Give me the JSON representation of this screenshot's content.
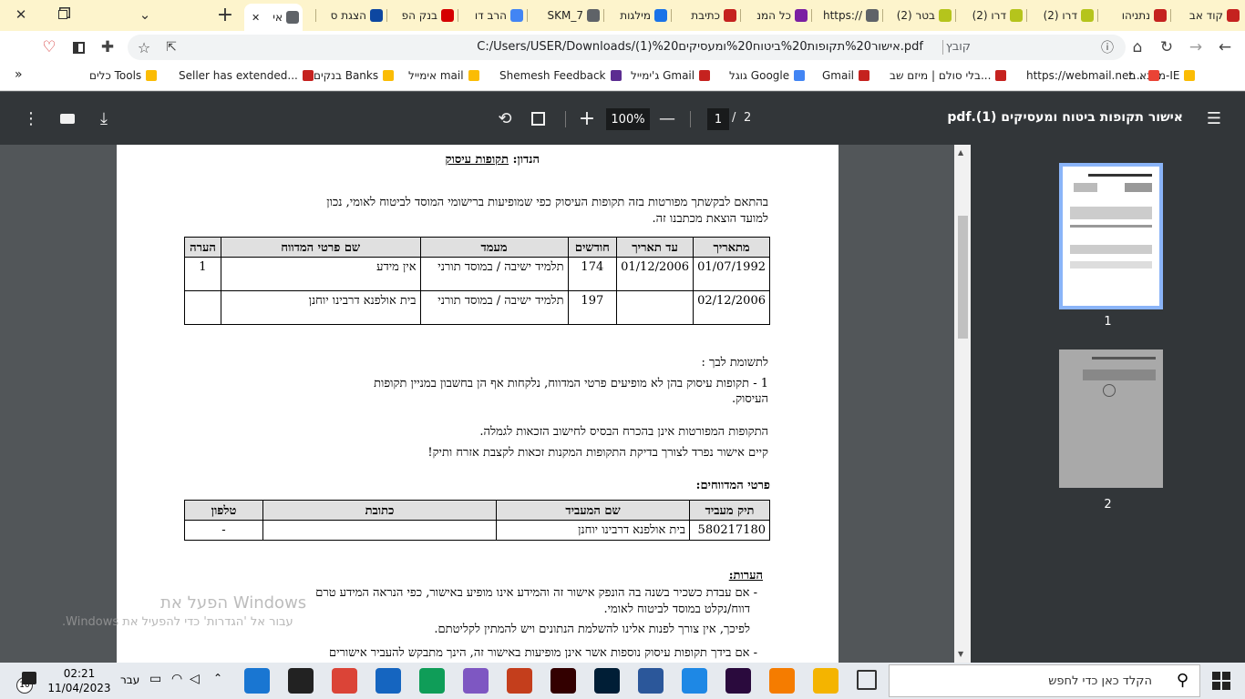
{
  "browser": {
    "tabs": [
      {
        "label": "קוד אב",
        "color": "#c5221f"
      },
      {
        "label": "נתניהו",
        "color": "#c5221f"
      },
      {
        "label": "(2) דרו",
        "color": "#b5c41c"
      },
      {
        "label": "(2) דרו",
        "color": "#b5c41c"
      },
      {
        "label": "(2) בטר",
        "color": "#b5c41c"
      },
      {
        "label": "https://",
        "color": "#5f6368"
      },
      {
        "label": "כל המנ",
        "color": "#7b1fa2"
      },
      {
        "label": "כתיבת",
        "color": "#c5221f"
      },
      {
        "label": "מילגות",
        "color": "#1a73e8"
      },
      {
        "label": "SKM_7",
        "color": "#5f6368"
      },
      {
        "label": "הרב דו",
        "color": "#4285f4"
      },
      {
        "label": "בנק הפ",
        "color": "#d50000"
      },
      {
        "label": "הצגת ס",
        "color": "#0d47a1"
      },
      {
        "label": "אי",
        "color": "#5f6368"
      }
    ],
    "window_controls": {
      "minimize": "chevron-down-icon",
      "restore": "restore-icon",
      "close": "close-icon"
    },
    "new_tab": "+",
    "address": {
      "scheme_label": "קובץ",
      "url": "C:/Users/USER/Downloads/(1)%20אישור%20תקופות%20ביטוח%20ומעסיקים.pdf"
    },
    "bookmarks": [
      {
        "label": "מיובא מ-IE",
        "color": "#fbbc04"
      },
      {
        "label": "https://webmail.net...",
        "color": "#ea4335"
      },
      {
        "label": "בלי סולם | מיזם שב...",
        "color": "#c5221f"
      },
      {
        "label": "Gmail",
        "color": "#c5221f"
      },
      {
        "label": "גוגל Google",
        "color": "#4285f4"
      },
      {
        "label": "ג'ימייל Gmail",
        "color": "#c5221f"
      },
      {
        "label": "Shemesh Feedback",
        "color": "#5c2d91"
      },
      {
        "label": "אימייל mail",
        "color": "#fbbc04"
      },
      {
        "label": "בנקים Banks",
        "color": "#fbbc04"
      },
      {
        "label": "Seller has extended...",
        "color": "#c5221f"
      },
      {
        "label": "כלים Tools",
        "color": "#fbbc04"
      }
    ],
    "bookmarks_overflow": "»"
  },
  "pdf_toolbar": {
    "title": "אישור תקופות ביטוח ומעסיקים (1).pdf",
    "page_current": "1",
    "page_separator": "/",
    "page_total": "2",
    "zoom": "100%",
    "zoom_in": "+",
    "zoom_out": "—"
  },
  "document": {
    "subject_prefix": "הנדון:",
    "subject": "תקופות עיסוק",
    "intro_line1": "בהתאם לבקשתך מפורטות בזה תקופות העיסוק כפי שמופיעות ברישומי המוסד לביטוח לאומי, נכון",
    "intro_line2": "למועד הוצאת מכתבנו זה.",
    "periods_table": {
      "headers": [
        "מתאריך",
        "עד תאריך",
        "חודשים",
        "מעמד",
        "שם פרטי המדווח",
        "הערה"
      ],
      "rows": [
        [
          "01/07/1992",
          "01/12/2006",
          "174",
          "תלמיד ישיבה / במוסד תורני",
          "אין מידע",
          "1"
        ],
        [
          "02/12/2006",
          "",
          "197",
          "תלמיד ישיבה / במוסד תורני",
          "בית אולפנא דרבינו יוחנן",
          ""
        ]
      ]
    },
    "attention": "לתשומת לבך :",
    "note1_line1": "1 - תקופות עיסוק בהן לא מופיעים פרטי המדווח, נלקחות אף הן בחשבון במניין תקופות",
    "note1_line2": "העיסוק.",
    "para1": "התקופות המפורטות אינן בהכרח הבסיס לחישוב הזכאות לגמלה.",
    "para2": "קיים אישור נפרד לצורך בדיקת התקופות המקנות זכאות לקצבת אזרח ותיק!",
    "reporters_heading": "פרטי המדווחים:",
    "reporters_table": {
      "headers": [
        "תיק מעביד",
        "שם המעביד",
        "כתובת",
        "טלפון"
      ],
      "rows": [
        [
          "580217180",
          "בית אולפנא דרבינו יוחנן",
          "",
          "-"
        ]
      ]
    },
    "remarks_heading": "הערות:",
    "remark1_line1": "- אם עבדת כשכיר בשנה בה הונפק אישור זה והמידע אינו מופיע באישור, כפי הנראה המידע טרם",
    "remark1_line2": "דווח/נקלט במוסד לביטוח לאומי.",
    "remark1_line3": "לפיכך, אין צורך לפנות אלינו להשלמת הנתונים ויש להמתין לקליטתם.",
    "remark2_line1": "- אם בידך תקופות עיסוק נוספות אשר אינן מופיעות באישור זה, הינך מתבקש להעביר אישורים"
  },
  "thumbnails": [
    {
      "label": "1"
    },
    {
      "label": "2"
    }
  ],
  "watermark": {
    "line1": "הפעל את Windows",
    "line2": "עבור אל 'הגדרות' כדי להפעיל את Windows."
  },
  "taskbar": {
    "search_placeholder": "הקלד כאן כדי לחפש",
    "time": "02:21",
    "date": "11/04/2023",
    "language": "עבר",
    "notifications": "10"
  }
}
